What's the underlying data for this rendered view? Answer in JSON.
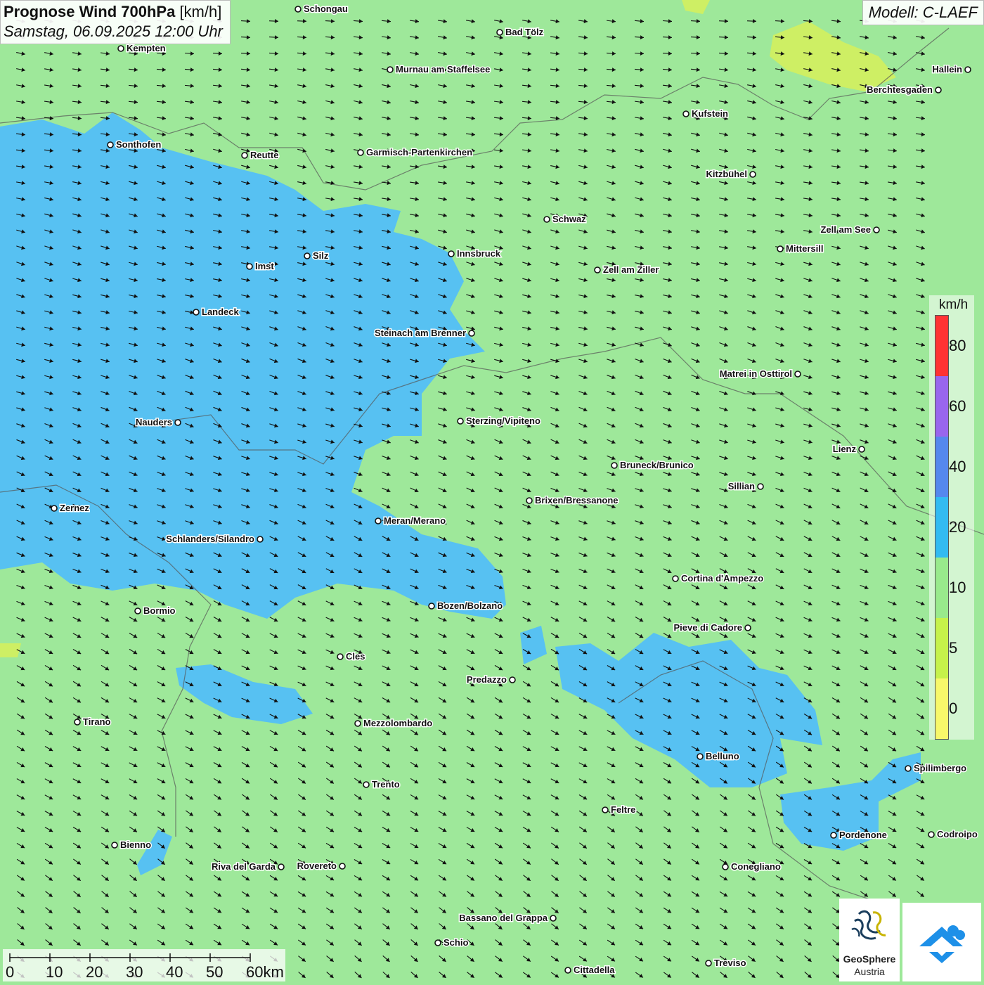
{
  "title": {
    "main": "Prognose Wind 700hPa",
    "unit": "[km/h]",
    "date": "Samstag, 06.09.2025 12:00 Uhr"
  },
  "model": "Modell: C-LAEF",
  "legend": {
    "unit": "km/h",
    "labels": [
      "80",
      "60",
      "40",
      "20",
      "10",
      "5",
      "0"
    ],
    "colors": [
      "#ff3333",
      "#9966ee",
      "#5588ee",
      "#33bbf2",
      "#99ea8c",
      "#c6f24a",
      "#f8f86a"
    ]
  },
  "cities": [
    {
      "name": "Schongau"
    },
    {
      "name": "Bad Tölz"
    },
    {
      "name": "Kempten"
    },
    {
      "name": "Murnau am Staffelsee"
    },
    {
      "name": "Hallein"
    },
    {
      "name": "Berchtesgaden"
    },
    {
      "name": "Kufstein"
    },
    {
      "name": "Sonthofen"
    },
    {
      "name": "Reutte"
    },
    {
      "name": "Garmisch-Partenkirchen"
    },
    {
      "name": "Kitzbühel"
    },
    {
      "name": "Schwaz"
    },
    {
      "name": "Zell am See"
    },
    {
      "name": "Innsbruck"
    },
    {
      "name": "Mittersill"
    },
    {
      "name": "Silz"
    },
    {
      "name": "Imst"
    },
    {
      "name": "Zell am Ziller"
    },
    {
      "name": "Landeck"
    },
    {
      "name": "Steinach am Brenner"
    },
    {
      "name": "Matrei in Osttirol"
    },
    {
      "name": "Nauders"
    },
    {
      "name": "Sterzing/Vipiteno"
    },
    {
      "name": "Lienz"
    },
    {
      "name": "Bruneck/Brunico"
    },
    {
      "name": "Sillian"
    },
    {
      "name": "Zernez"
    },
    {
      "name": "Brixen/Bressanone"
    },
    {
      "name": "Meran/Merano"
    },
    {
      "name": "Schlanders/Silandro"
    },
    {
      "name": "Cortina d'Ampezzo"
    },
    {
      "name": "Bozen/Bolzano"
    },
    {
      "name": "Bormio"
    },
    {
      "name": "Pieve di Cadore"
    },
    {
      "name": "Cles"
    },
    {
      "name": "Predazzo"
    },
    {
      "name": "Tirano"
    },
    {
      "name": "Mezzolombardo"
    },
    {
      "name": "Belluno"
    },
    {
      "name": "Spilimbergo"
    },
    {
      "name": "Trento"
    },
    {
      "name": "Feltre"
    },
    {
      "name": "Pordenone"
    },
    {
      "name": "Codroipo"
    },
    {
      "name": "Bienno"
    },
    {
      "name": "Riva del Garda"
    },
    {
      "name": "Rovereto"
    },
    {
      "name": "Conegliano"
    },
    {
      "name": "Bassano del Grappa"
    },
    {
      "name": "Schio"
    },
    {
      "name": "Treviso"
    },
    {
      "name": "Cittadella"
    }
  ],
  "scalebar": {
    "labels": [
      "0",
      "10",
      "20",
      "30",
      "40",
      "50",
      "60km"
    ]
  },
  "logo": {
    "name": "GeoSphere",
    "sub": "Austria"
  },
  "icons": {
    "geosphere": "geosphere-logo-icon",
    "partner": "cloud-arrow-logo-icon"
  }
}
